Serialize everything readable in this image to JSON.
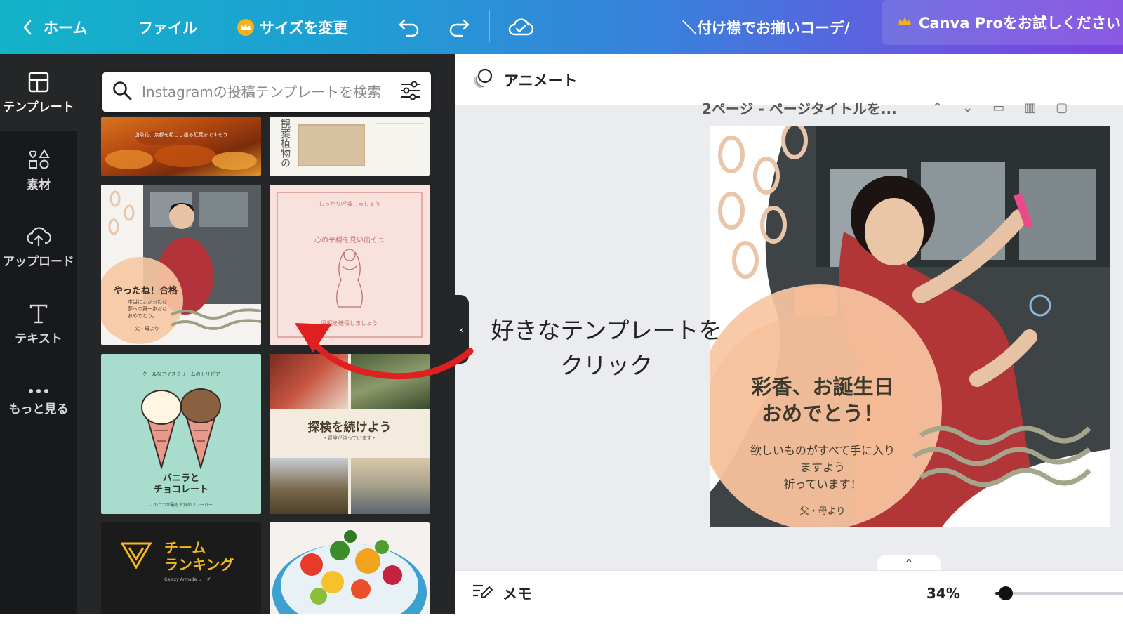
{
  "topbar": {
    "home_label": "ホーム",
    "file_label": "ファイル",
    "resize_label": "サイズを変更",
    "design_title": "＼付け襟でお揃いコーデ/",
    "pro_label": "Canva Proをお試しください"
  },
  "sidebar": {
    "items": [
      {
        "label": "テンプレート"
      },
      {
        "label": "素材"
      },
      {
        "label": "アップロード"
      },
      {
        "label": "テキスト"
      },
      {
        "label": "もっと見る"
      }
    ]
  },
  "panel": {
    "search_placeholder": "Instagramの投稿テンプレートを検索",
    "templates": [
      {
        "text": "山茶花、京都を起こし出る紅葉まですもう"
      },
      {
        "text": "観葉植物の"
      },
      {
        "title": "やったね！合格",
        "body": "本当によかったね\n夢への第一歩だね\nおめでとう。",
        "sign": "父・母より"
      },
      {
        "top": "しっかり呼吸しましょう",
        "arc": "心の平穏を見い出そう",
        "bottom": "睡眠を確保しましょう"
      },
      {
        "top": "クールなアイスクリームのトリビア",
        "title_line1": "バニラと",
        "title_line2": "チョコレート",
        "bottom": "このニつが最も人気のフレーバー"
      },
      {
        "title": "探検を続けよう",
        "sub": "・冒険が待っています・"
      },
      {
        "title_line1": "チーム",
        "title_line2": "ランキング",
        "sub": "Galaxy Armada リーグ"
      },
      {
        "text": ""
      }
    ]
  },
  "canvas": {
    "animate_label": "アニメート",
    "page_title": "2ページ - ページタイトルを...",
    "design": {
      "title_line1": "彩香、お誕生日",
      "title_line2": "おめでとう！",
      "message_line1": "欲しいものがすべて手に入り",
      "message_line2": "ますよう",
      "message_line3": "祈っています！",
      "sign": "父・母より"
    },
    "memo_label": "メモ",
    "zoom_label": "34%",
    "zoom_value": 34
  },
  "annotation": {
    "line1": "好きなテンプレートを",
    "line2": "クリック"
  },
  "colors": {
    "accent_red": "#e02020",
    "sidebar_bg": "#18191b",
    "panel_bg": "#252627",
    "brand_purple": "#8b3dff"
  }
}
